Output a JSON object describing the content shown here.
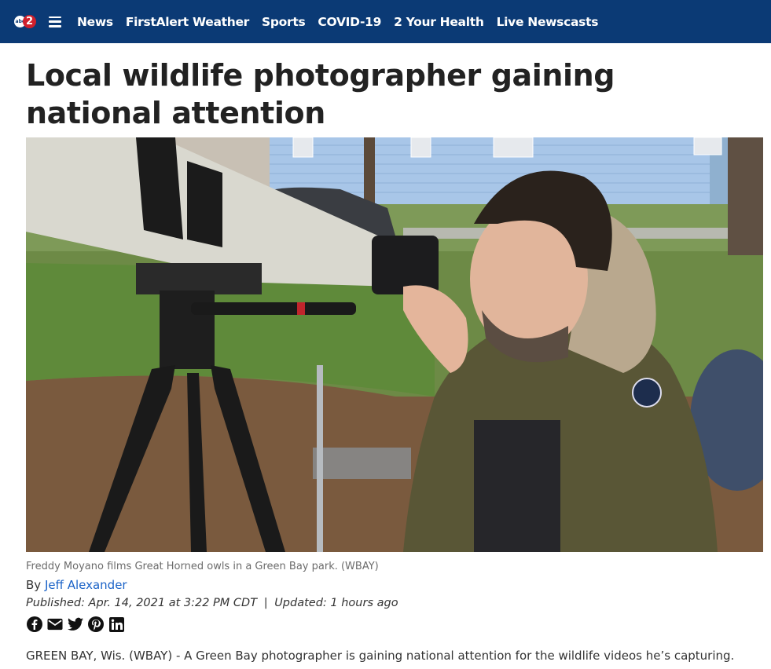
{
  "header": {
    "logo_abc": "abc",
    "logo_number": "2",
    "nav": [
      "News",
      "FirstAlert Weather",
      "Sports",
      "COVID-19",
      "2 Your Health",
      "Live Newscasts"
    ],
    "bg_color": "#0b3a75"
  },
  "article": {
    "headline": "Local wildlife photographer gaining national attention",
    "image_alt": "Freddy Moyano films Great Horned owls in a Green Bay park.",
    "caption": "Freddy Moyano films Great Horned owls in a Green Bay park.  (WBAY)",
    "byline_prefix": "By",
    "author": "Jeff Alexander",
    "published": "Published: Apr. 14, 2021 at 3:22 PM CDT",
    "separator": "|",
    "updated": "Updated: 1 hours ago",
    "share_icons": [
      "facebook-icon",
      "email-icon",
      "twitter-icon",
      "pinterest-icon",
      "linkedin-icon"
    ],
    "body_first_line": "GREEN BAY, Wis. (WBAY) - A Green Bay photographer is gaining national attention for the wildlife videos he’s capturing.",
    "link_color": "#1a62c7"
  }
}
